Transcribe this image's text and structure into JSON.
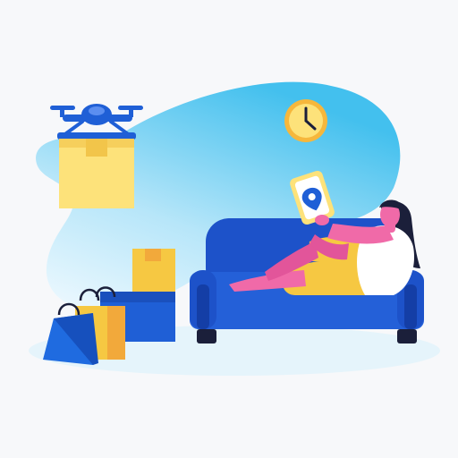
{
  "scene": {
    "background": "#f7f8fa",
    "illustration": "home-delivery-drone",
    "colors": {
      "sky_blob_light": "#e6f6fd",
      "sky_blob_deep": "#4cc3ef",
      "floor": "#e5f4fb",
      "drone_blue": "#1f5fd6",
      "box_yellow": "#fde27a",
      "box_yellow_shade": "#f2c54a",
      "box_blue": "#1f5fd6",
      "sofa_blue": "#1d52c9",
      "sofa_dark": "#143ea6",
      "skin_pink": "#f06aa8",
      "shirt_white": "#ffffff",
      "pants_yellow": "#f6c842",
      "hair_dark": "#1b1f3a",
      "clock_face": "#fde27a",
      "clock_ring": "#f6b73c",
      "bag_blue": "#1f6be0",
      "bag_yellow": "#f6c842"
    },
    "icons": [
      "drone-icon",
      "clock-icon",
      "tablet-icon",
      "location-pin-icon",
      "shopping-bag-icon",
      "package-icon",
      "sofa-icon"
    ]
  }
}
